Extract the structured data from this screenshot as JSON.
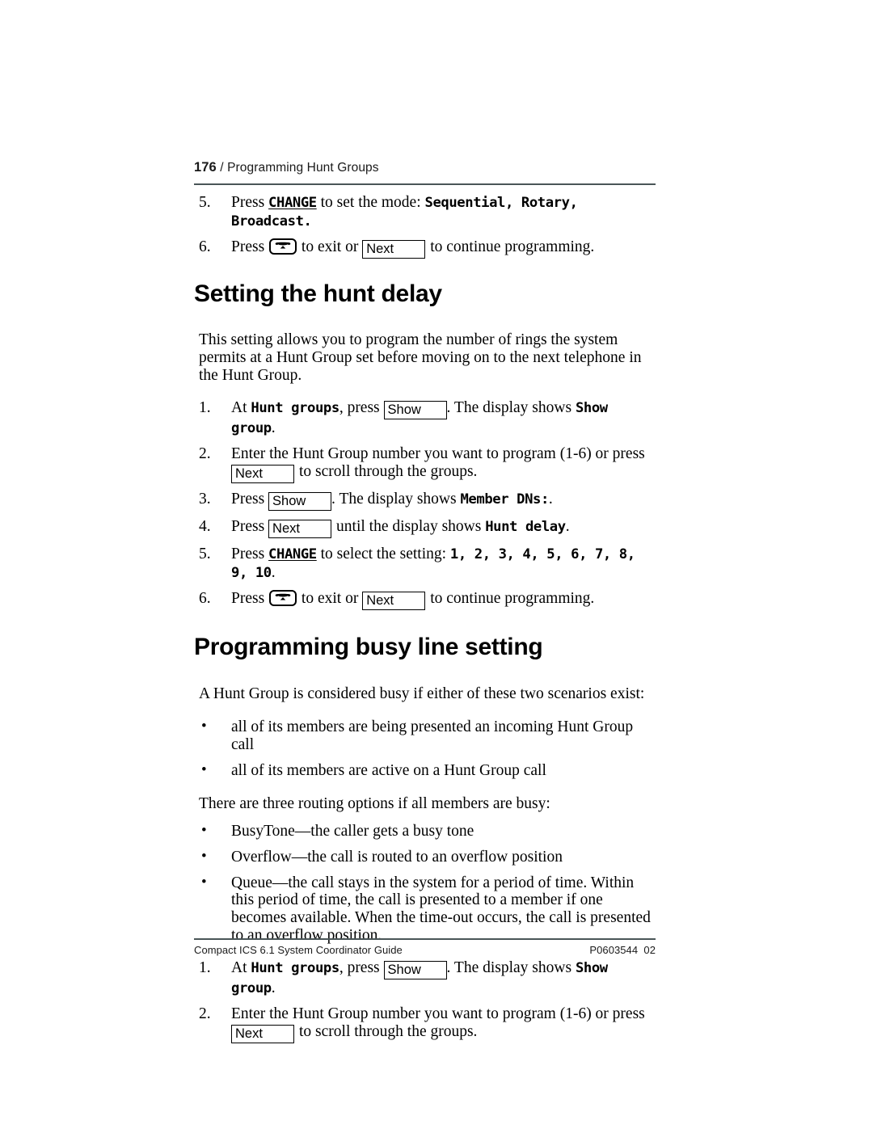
{
  "header": {
    "folio": "176",
    "separator": "/",
    "chapter": "Programming Hunt Groups"
  },
  "footer": {
    "guide": "Compact ICS 6.1 System Coordinator Guide",
    "doc_code": "P0603544  02"
  },
  "softkeys": {
    "show": "Show",
    "next": "Next"
  },
  "icons": {
    "release_key": "telephone-handset-release-icon"
  },
  "continued_steps": {
    "step5": {
      "marker": "5.",
      "press": "Press",
      "key": "CHANGE",
      "text_mid": "to set the mode:",
      "modes": "Sequential, Rotary, Broadcast."
    },
    "step6": {
      "marker": "6.",
      "press": "Press",
      "text_mid": "to exit or",
      "text_end": "to continue programming."
    }
  },
  "section_hunt_delay": {
    "title": "Setting the hunt delay",
    "intro": "This setting allows you to program the number of rings the system permits at a Hunt Group set before moving on to the next telephone in the Hunt Group.",
    "steps": [
      {
        "marker": "1.",
        "pre": "At",
        "display1": "Hunt groups",
        "mid": ", press",
        "post": ". The display shows",
        "display2": "Show group",
        "end": "."
      },
      {
        "marker": "2.",
        "pre": "Enter the Hunt Group number you want to program (1-6) or press",
        "post": "to scroll through the groups."
      },
      {
        "marker": "3.",
        "pre": "Press",
        "post": ". The display shows",
        "display2": "Member DNs:",
        "end": "."
      },
      {
        "marker": "4.",
        "pre": "Press",
        "post": "until the display shows",
        "display2": "Hunt delay",
        "end": "."
      },
      {
        "marker": "5.",
        "pre": "Press",
        "key": "CHANGE",
        "mid": "to select the setting:",
        "display2": "1, 2, 3, 4, 5, 6, 7, 8, 9, 10",
        "end": "."
      },
      {
        "marker": "6.",
        "pre": "Press",
        "mid": "to exit or",
        "post": "to continue programming."
      }
    ]
  },
  "section_busy_line": {
    "title": "Programming busy line setting",
    "intro": "A Hunt Group is considered busy if either of these two scenarios exist:",
    "busy_scenarios": [
      "all of its members are being presented an incoming Hunt Group call",
      "all of its members are active on a Hunt Group call"
    ],
    "routing_intro": "There are three routing options if all members are busy:",
    "routing_options": [
      "BusyTone—the caller gets a busy tone",
      "Overflow—the call is routed to an overflow position",
      "Queue—the call stays in the system for a period of time. Within this period of time, the call is presented to a member if one becomes available. When the time-out occurs, the call is presented to an overflow position."
    ],
    "bullet_glyph": "•",
    "steps": [
      {
        "marker": "1.",
        "pre": "At",
        "display1": "Hunt groups",
        "mid": ", press",
        "post": ". The display shows",
        "display2": "Show group",
        "end": "."
      },
      {
        "marker": "2.",
        "pre": "Enter the Hunt Group number you want to program (1-6) or press",
        "post": "to scroll through the groups."
      }
    ]
  }
}
